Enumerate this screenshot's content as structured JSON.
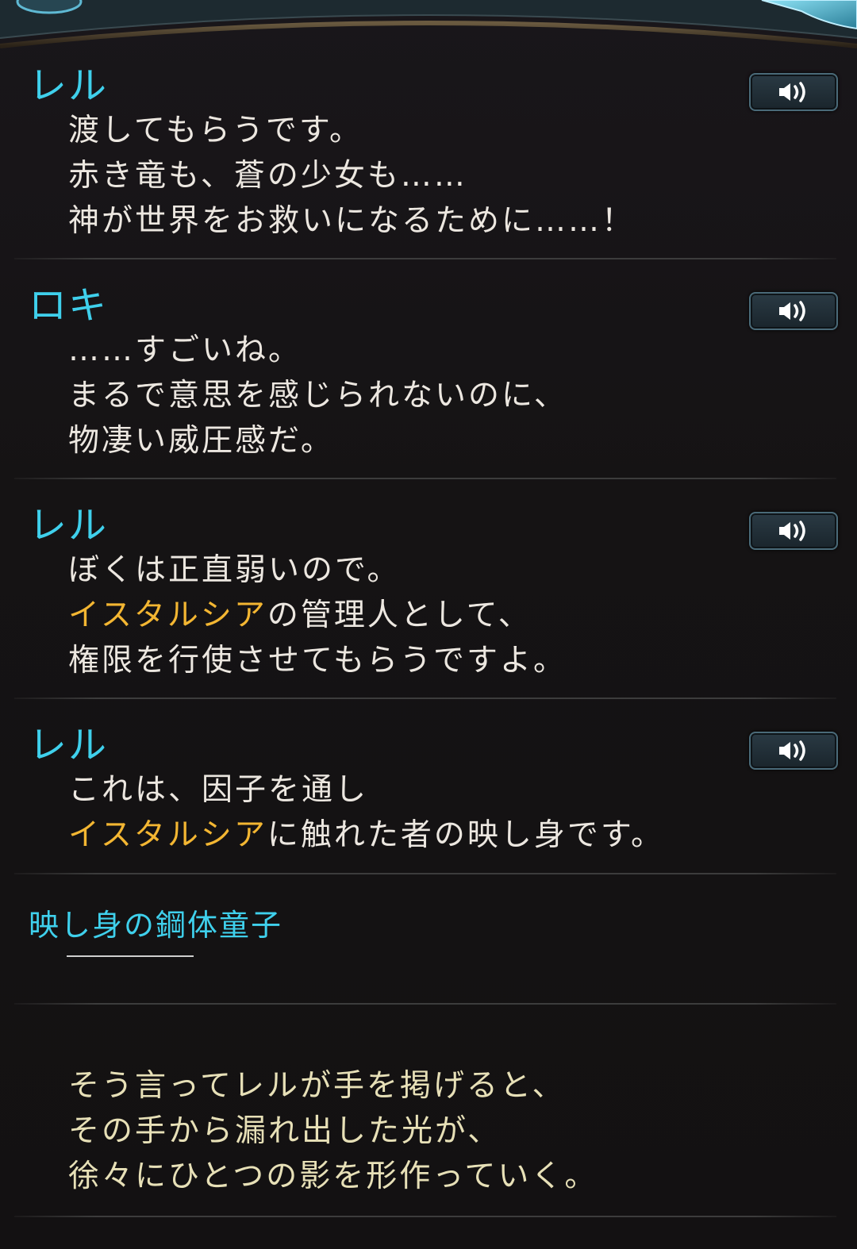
{
  "entries": [
    {
      "speaker": "レル",
      "lines": [
        [
          {
            "t": "渡してもらうです。"
          }
        ],
        [
          {
            "t": "赤き竜も、蒼の少女も……"
          }
        ],
        [
          {
            "t": "神が世界をお救いになるために……！"
          }
        ]
      ],
      "has_voice": true
    },
    {
      "speaker": "ロキ",
      "lines": [
        [
          {
            "t": "……すごいね。"
          }
        ],
        [
          {
            "t": "まるで意思を感じられないのに、"
          }
        ],
        [
          {
            "t": "物凄い威圧感だ。"
          }
        ]
      ],
      "has_voice": true
    },
    {
      "speaker": "レル",
      "lines": [
        [
          {
            "t": "ぼくは正直弱いので。"
          }
        ],
        [
          {
            "t": "イスタルシア",
            "hl": true
          },
          {
            "t": "の管理人として、"
          }
        ],
        [
          {
            "t": "権限を行使させてもらうですよ。"
          }
        ]
      ],
      "has_voice": true
    },
    {
      "speaker": "レル",
      "lines": [
        [
          {
            "t": "これは、因子を通し"
          }
        ],
        [
          {
            "t": "イスタルシア",
            "hl": true
          },
          {
            "t": "に触れた者の映し身です。"
          }
        ]
      ],
      "has_voice": true
    },
    {
      "speaker": "映し身の鋼体童子",
      "lines": [],
      "has_voice": false
    }
  ],
  "narration": [
    "そう言ってレルが手を掲げると、",
    "その手から漏れ出した光が、",
    "徐々にひとつの影を形作っていく。"
  ],
  "colors": {
    "speaker": "#3fd0ec",
    "highlight": "#f3b632",
    "text": "#ece7e0",
    "narration": "#e7e0b7",
    "background": "#141213"
  },
  "icons": {
    "voice": "speaker-icon"
  }
}
